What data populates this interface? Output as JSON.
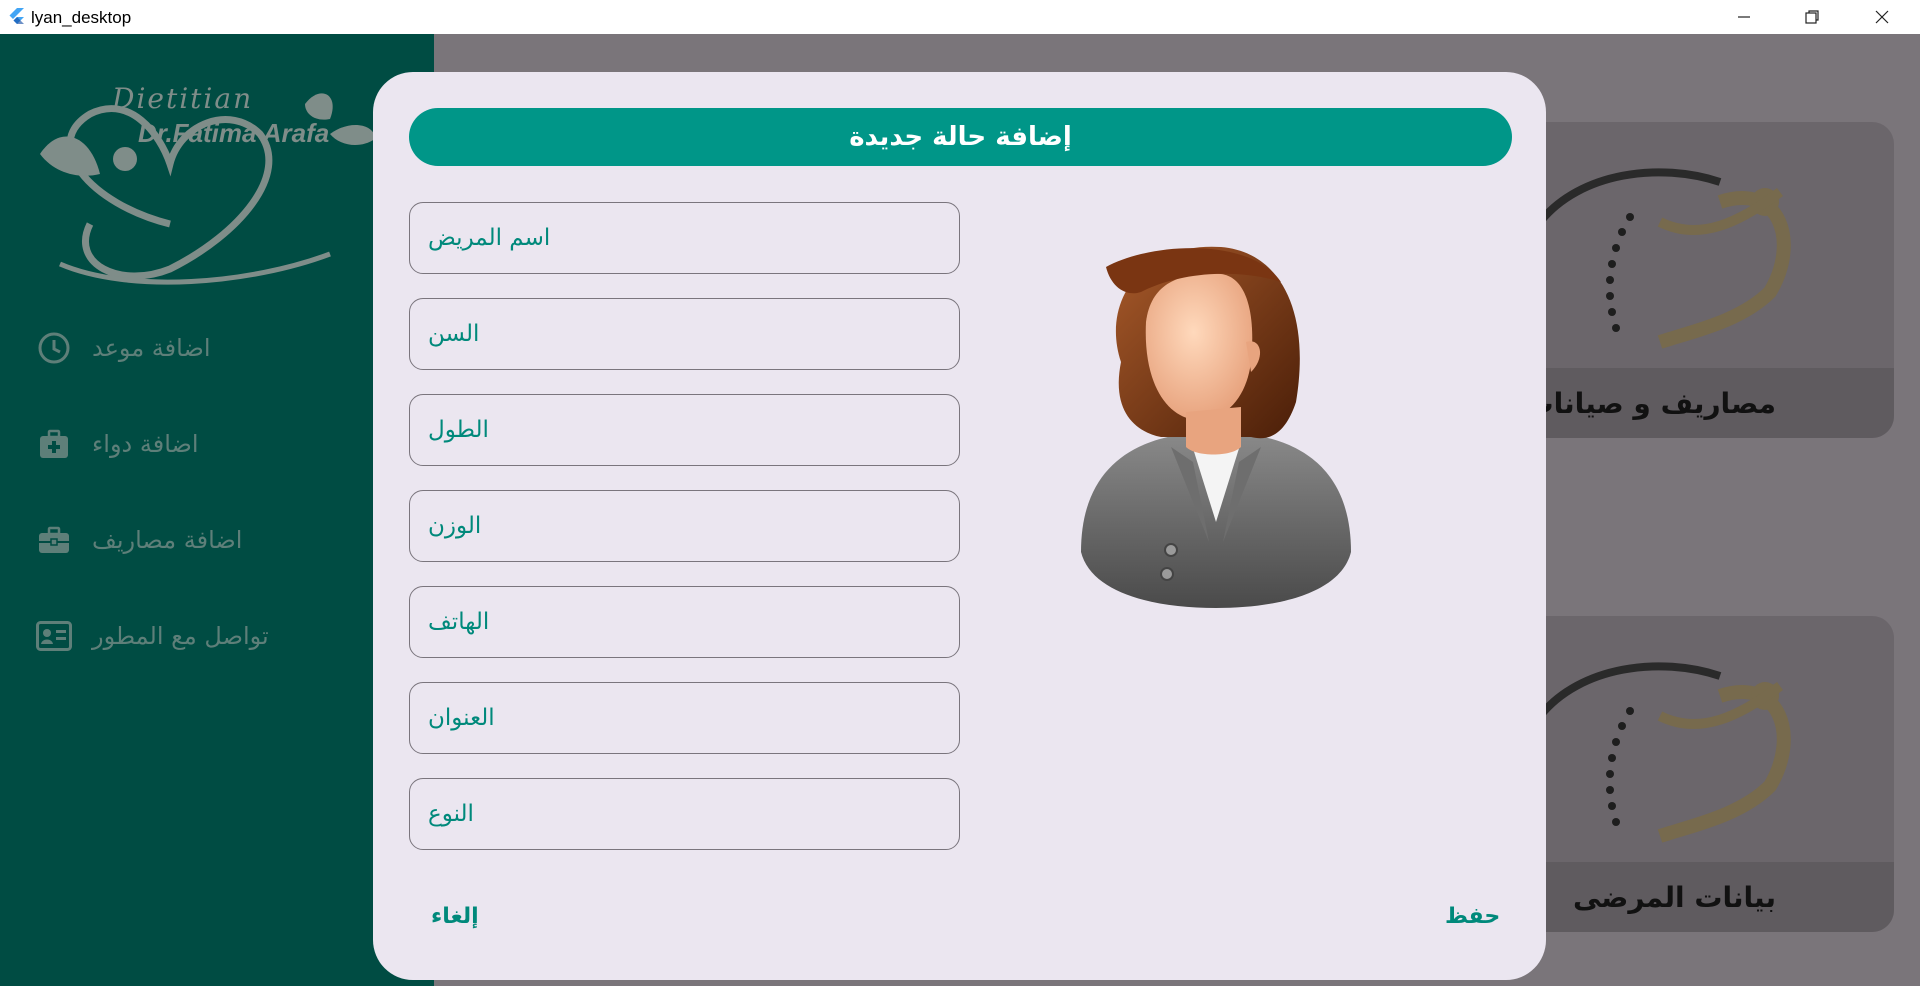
{
  "window": {
    "title": "lyan_desktop",
    "icons": {
      "app": "flutter-icon",
      "minimize": "minimize-icon",
      "maximize": "restore-icon",
      "close": "close-icon"
    }
  },
  "sidebar": {
    "logo": {
      "line1": "Dietitian",
      "line2": "Dr.Fatima Arafa"
    },
    "items": [
      {
        "label": "اضافة موعد",
        "icon": "clock-icon"
      },
      {
        "label": "اضافة دواء",
        "icon": "medical-kit-icon"
      },
      {
        "label": "اضافة مصاريف",
        "icon": "briefcase-icon"
      },
      {
        "label": "تواصل مع المطور",
        "icon": "contact-card-icon"
      }
    ]
  },
  "background_cards": [
    {
      "label": "مصاريف و صيانات"
    },
    {
      "label": "بيانات المرضى"
    }
  ],
  "dialog": {
    "title": "إضافة حالة جديدة",
    "fields": [
      {
        "placeholder": "اسم المريض",
        "value": ""
      },
      {
        "placeholder": "السن",
        "value": ""
      },
      {
        "placeholder": "الطول",
        "value": ""
      },
      {
        "placeholder": "الوزن",
        "value": ""
      },
      {
        "placeholder": "الهاتف",
        "value": ""
      },
      {
        "placeholder": "العنوان",
        "value": ""
      },
      {
        "placeholder": "النوع",
        "value": ""
      }
    ],
    "cancel_label": "إلغاء",
    "save_label": "حفظ",
    "avatar_icon": "female-patient-avatar"
  },
  "colors": {
    "sidebar": "#004c43",
    "accent": "#009688",
    "dialog_bg": "#ebe6f0",
    "overlay": "#7a757a"
  }
}
